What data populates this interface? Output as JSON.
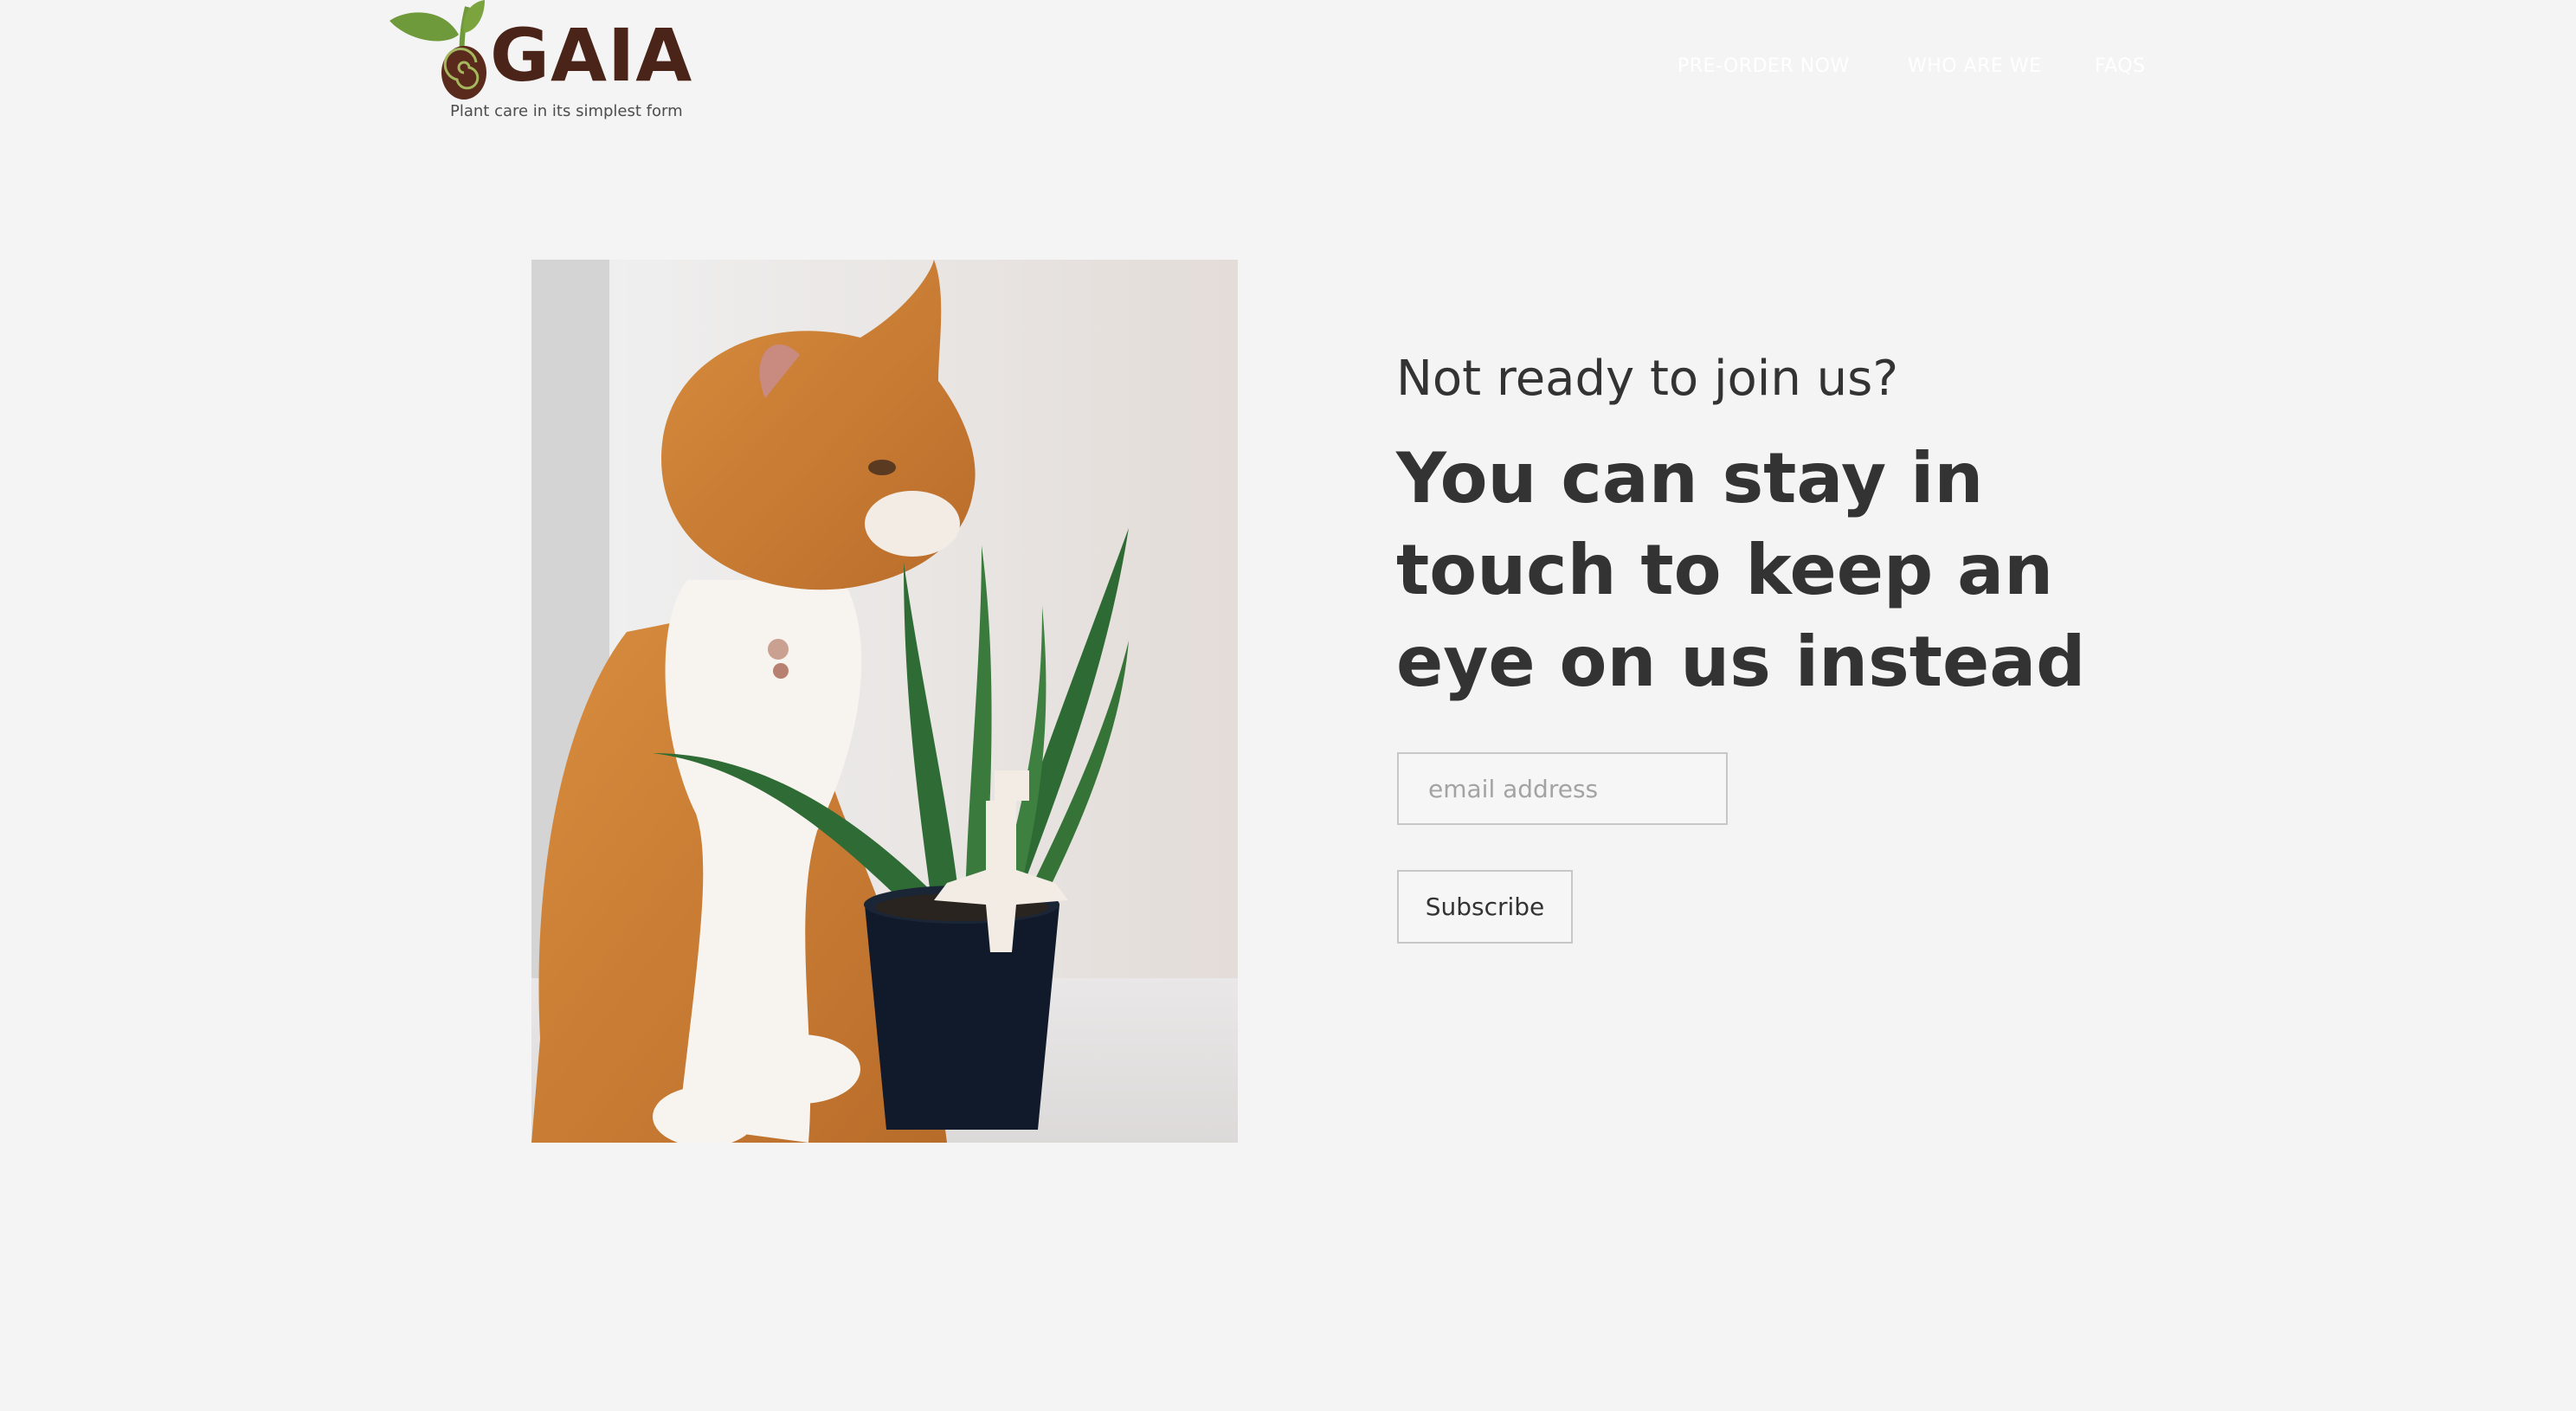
{
  "brand": {
    "name": "GAIA",
    "tagline": "Plant care in its simplest form",
    "colors": {
      "leaf": "#6f9a3c",
      "seed": "#5a2a1c",
      "text": "#4a2418"
    }
  },
  "nav": {
    "items": [
      {
        "label": "PRE-ORDER NOW"
      },
      {
        "label": "WHO ARE WE"
      },
      {
        "label": "FAQS"
      }
    ]
  },
  "hero": {
    "image": "cat sniffing aloe plant in black pot with white plant sensor",
    "subheading": "Not ready to join us?",
    "heading": "You can stay in touch to keep an eye on us instead"
  },
  "form": {
    "email_placeholder": "email address",
    "email_value": "",
    "subscribe_label": "Subscribe"
  },
  "colors": {
    "background": "#f4f4f4",
    "text": "#333333",
    "border": "#c7c7c7"
  }
}
